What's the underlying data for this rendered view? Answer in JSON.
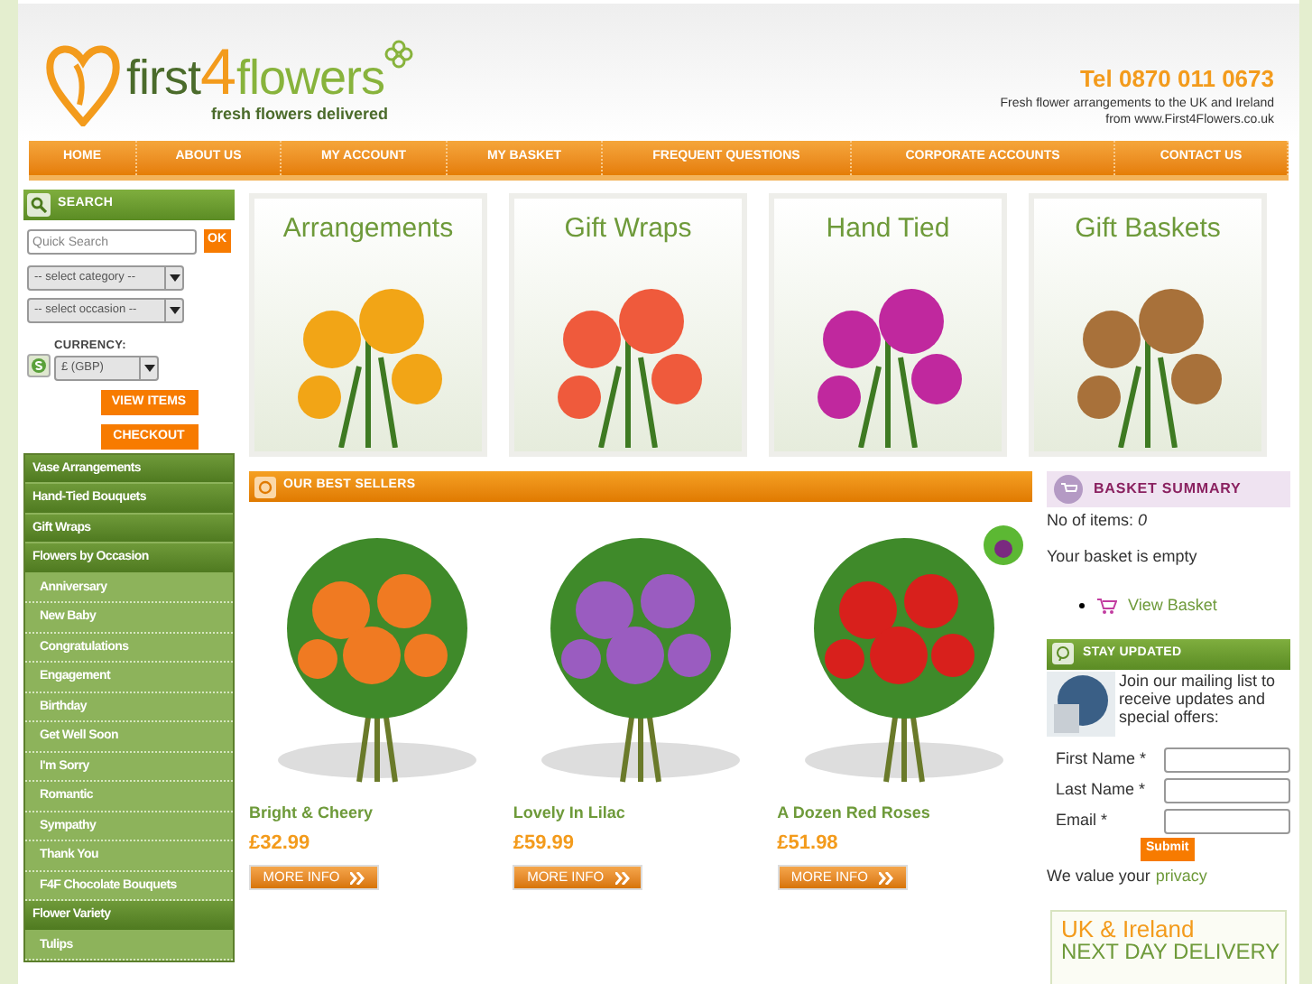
{
  "header": {
    "logo_text": "first",
    "logo_digit": "4",
    "logo_text_2": "flowers",
    "tagline": "fresh flowers delivered",
    "phone": "Tel 0870 011 0673",
    "blurb_1": "Fresh flower arrangements to the UK and Ireland",
    "blurb_2": "from www.First4Flowers.co.uk"
  },
  "nav": [
    "HOME",
    "ABOUT US",
    "MY ACCOUNT",
    "MY BASKET",
    "FREQUENT QUESTIONS",
    "CORPORATE ACCOUNTS",
    "CONTACT US"
  ],
  "search": {
    "title": "SEARCH",
    "placeholder": "Quick Search",
    "go": "OK",
    "category": "-- select category --",
    "occasion": "-- select occasion --",
    "currency_label": "CURRENCY:",
    "currency": "£ (GBP)",
    "view_items": "VIEW ITEMS",
    "checkout": "CHECKOUT"
  },
  "menu": [
    {
      "label": "Vase Arrangements"
    },
    {
      "label": "Hand-Tied Bouquets"
    },
    {
      "label": "Gift Wraps"
    },
    {
      "label": "Flowers by Occasion",
      "children": [
        {
          "label": "Anniversary"
        },
        {
          "label": "New Baby"
        },
        {
          "label": "Congratulations"
        },
        {
          "label": "Engagement"
        },
        {
          "label": "Birthday"
        },
        {
          "label": "Get Well Soon"
        },
        {
          "label": "I'm Sorry"
        },
        {
          "label": "Romantic"
        },
        {
          "label": "Sympathy"
        },
        {
          "label": "Thank You"
        },
        {
          "label": "F4F Chocolate Bouquets"
        }
      ]
    },
    {
      "label": "Flower Variety",
      "children": [
        {
          "label": "Tulips"
        }
      ]
    }
  ],
  "tiles": [
    {
      "title": "Arrangements",
      "color": "#f2a516"
    },
    {
      "title": "Gift Wraps",
      "color": "#ef5a3c"
    },
    {
      "title": "Hand Tied",
      "color": "#c0289e"
    },
    {
      "title": "Gift Baskets",
      "color": "#a8713a"
    }
  ],
  "best_sellers": {
    "title": "OUR BEST SELLERS",
    "products": [
      {
        "name": "Bright & Cheery",
        "price": "£32.99",
        "button": "MORE INFO",
        "color": "#f07a22",
        "badge": false
      },
      {
        "name": "Lovely In Lilac",
        "price": "£59.99",
        "button": "MORE INFO",
        "color": "#9a5cc0",
        "badge": false
      },
      {
        "name": "A Dozen Red Roses",
        "price": "£51.98",
        "button": "MORE INFO",
        "color": "#d8201c",
        "badge": true
      }
    ]
  },
  "basket": {
    "title": "BASKET SUMMARY",
    "items": "No of items: *0*",
    "status": "Your basket is empty",
    "link": "View Basket"
  },
  "newsletter": {
    "title": "STAY UPDATED",
    "intro": "Join our mailing list to receive updates and special offers:",
    "fields": [
      "First Name *",
      "Last Name *",
      "Email *"
    ],
    "submit": "Submit",
    "privacy_text": "We value your",
    "privacy_link": "privacy"
  },
  "delivery": {
    "line_1": "UK & Ireland",
    "line_2": "NEXT DAY DELIVERY"
  }
}
